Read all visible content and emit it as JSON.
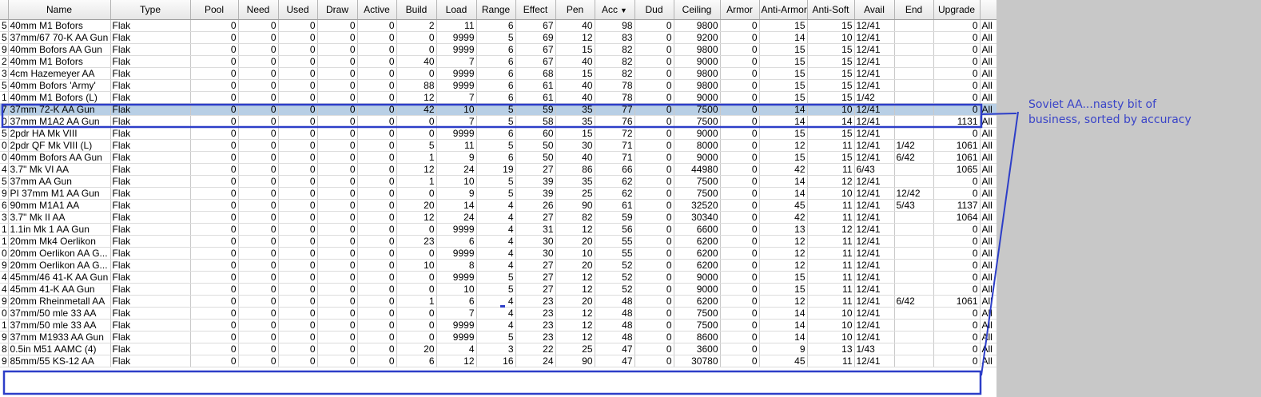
{
  "columns": [
    "",
    "Name",
    "Type",
    "Pool",
    "Need",
    "Used",
    "Draw",
    "Active",
    "Build",
    "Load",
    "Range",
    "Effect",
    "Pen",
    "Acc",
    "Dud",
    "Ceiling",
    "Armor",
    "Anti-Armor",
    "Anti-Soft",
    "Avail",
    "End",
    "Upgrade",
    ""
  ],
  "sort_indicator": "▼",
  "rows": [
    [
      "5",
      "40mm M1 Bofors",
      "Flak",
      "0",
      "0",
      "0",
      "0",
      "0",
      "2",
      "11",
      "6",
      "67",
      "40",
      "98",
      "0",
      "9800",
      "0",
      "15",
      "15",
      "12/41",
      "",
      "0",
      "All"
    ],
    [
      "5",
      "37mm/67 70-K AA Gun",
      "Flak",
      "0",
      "0",
      "0",
      "0",
      "0",
      "0",
      "9999",
      "5",
      "69",
      "12",
      "83",
      "0",
      "9200",
      "0",
      "14",
      "10",
      "12/41",
      "",
      "0",
      "All"
    ],
    [
      "9",
      "40mm Bofors AA Gun",
      "Flak",
      "0",
      "0",
      "0",
      "0",
      "0",
      "0",
      "9999",
      "6",
      "67",
      "15",
      "82",
      "0",
      "9800",
      "0",
      "15",
      "15",
      "12/41",
      "",
      "0",
      "All"
    ],
    [
      "2",
      "40mm M1 Bofors",
      "Flak",
      "0",
      "0",
      "0",
      "0",
      "0",
      "40",
      "7",
      "6",
      "67",
      "40",
      "82",
      "0",
      "9000",
      "0",
      "15",
      "15",
      "12/41",
      "",
      "0",
      "All"
    ],
    [
      "3",
      "4cm Hazemeyer AA",
      "Flak",
      "0",
      "0",
      "0",
      "0",
      "0",
      "0",
      "9999",
      "6",
      "68",
      "15",
      "82",
      "0",
      "9800",
      "0",
      "15",
      "15",
      "12/41",
      "",
      "0",
      "All"
    ],
    [
      "5",
      "40mm Bofors 'Army'",
      "Flak",
      "0",
      "0",
      "0",
      "0",
      "0",
      "88",
      "9999",
      "6",
      "61",
      "40",
      "78",
      "0",
      "9800",
      "0",
      "15",
      "15",
      "12/41",
      "",
      "0",
      "All"
    ],
    [
      "1",
      "40mm M1 Bofors (L)",
      "Flak",
      "0",
      "0",
      "0",
      "0",
      "0",
      "12",
      "7",
      "6",
      "61",
      "40",
      "78",
      "0",
      "9000",
      "0",
      "15",
      "15",
      "1/42",
      "",
      "0",
      "All"
    ],
    [
      "7",
      "37mm 72-K AA Gun",
      "Flak",
      "0",
      "0",
      "0",
      "0",
      "0",
      "42",
      "10",
      "5",
      "59",
      "35",
      "77",
      "0",
      "7500",
      "0",
      "14",
      "10",
      "12/41",
      "",
      "0",
      "All"
    ],
    [
      "0",
      "37mm M1A2 AA Gun",
      "Flak",
      "0",
      "0",
      "0",
      "0",
      "0",
      "0",
      "7",
      "5",
      "58",
      "35",
      "76",
      "0",
      "7500",
      "0",
      "14",
      "14",
      "12/41",
      "",
      "1131",
      "All"
    ],
    [
      "5",
      "2pdr HA Mk VIII",
      "Flak",
      "0",
      "0",
      "0",
      "0",
      "0",
      "0",
      "9999",
      "6",
      "60",
      "15",
      "72",
      "0",
      "9000",
      "0",
      "15",
      "15",
      "12/41",
      "",
      "0",
      "All"
    ],
    [
      "0",
      "2pdr QF Mk VIII (L)",
      "Flak",
      "0",
      "0",
      "0",
      "0",
      "0",
      "5",
      "11",
      "5",
      "50",
      "30",
      "71",
      "0",
      "8000",
      "0",
      "12",
      "11",
      "12/41",
      "1/42",
      "1061",
      "All"
    ],
    [
      "0",
      "40mm Bofors AA Gun",
      "Flak",
      "0",
      "0",
      "0",
      "0",
      "0",
      "1",
      "9",
      "6",
      "50",
      "40",
      "71",
      "0",
      "9000",
      "0",
      "15",
      "15",
      "12/41",
      "6/42",
      "1061",
      "All"
    ],
    [
      "4",
      "3.7\" Mk VI AA",
      "Flak",
      "0",
      "0",
      "0",
      "0",
      "0",
      "12",
      "24",
      "19",
      "27",
      "86",
      "66",
      "0",
      "44980",
      "0",
      "42",
      "11",
      "6/43",
      "",
      "1065",
      "All"
    ],
    [
      "5",
      "37mm AA Gun",
      "Flak",
      "0",
      "0",
      "0",
      "0",
      "0",
      "1",
      "10",
      "5",
      "39",
      "35",
      "62",
      "0",
      "7500",
      "0",
      "14",
      "12",
      "12/41",
      "",
      "0",
      "All"
    ],
    [
      "9",
      "PI 37mm M1 AA Gun",
      "Flak",
      "0",
      "0",
      "0",
      "0",
      "0",
      "0",
      "9",
      "5",
      "39",
      "25",
      "62",
      "0",
      "7500",
      "0",
      "14",
      "10",
      "12/41",
      "12/42",
      "0",
      "All"
    ],
    [
      "6",
      "90mm M1A1 AA",
      "Flak",
      "0",
      "0",
      "0",
      "0",
      "0",
      "20",
      "14",
      "4",
      "26",
      "90",
      "61",
      "0",
      "32520",
      "0",
      "45",
      "11",
      "12/41",
      "5/43",
      "1137",
      "All"
    ],
    [
      "3",
      "3.7\" Mk II AA",
      "Flak",
      "0",
      "0",
      "0",
      "0",
      "0",
      "12",
      "24",
      "4",
      "27",
      "82",
      "59",
      "0",
      "30340",
      "0",
      "42",
      "11",
      "12/41",
      "",
      "1064",
      "All"
    ],
    [
      "1",
      "1.1in Mk 1 AA Gun",
      "Flak",
      "0",
      "0",
      "0",
      "0",
      "0",
      "0",
      "9999",
      "4",
      "31",
      "12",
      "56",
      "0",
      "6600",
      "0",
      "13",
      "12",
      "12/41",
      "",
      "0",
      "All"
    ],
    [
      "1",
      "20mm Mk4 Oerlikon",
      "Flak",
      "0",
      "0",
      "0",
      "0",
      "0",
      "23",
      "6",
      "4",
      "30",
      "20",
      "55",
      "0",
      "6200",
      "0",
      "12",
      "11",
      "12/41",
      "",
      "0",
      "All"
    ],
    [
      "0",
      "20mm Oerlikon AA G...",
      "Flak",
      "0",
      "0",
      "0",
      "0",
      "0",
      "0",
      "9999",
      "4",
      "30",
      "10",
      "55",
      "0",
      "6200",
      "0",
      "12",
      "11",
      "12/41",
      "",
      "0",
      "All"
    ],
    [
      "9",
      "20mm Oerlikon AA G...",
      "Flak",
      "0",
      "0",
      "0",
      "0",
      "0",
      "10",
      "8",
      "4",
      "27",
      "20",
      "52",
      "0",
      "6200",
      "0",
      "12",
      "11",
      "12/41",
      "",
      "0",
      "All"
    ],
    [
      "4",
      "45mm/46 41-K AA Gun",
      "Flak",
      "0",
      "0",
      "0",
      "0",
      "0",
      "0",
      "9999",
      "5",
      "27",
      "12",
      "52",
      "0",
      "9000",
      "0",
      "15",
      "11",
      "12/41",
      "",
      "0",
      "All"
    ],
    [
      "4",
      "45mm 41-K AA Gun",
      "Flak",
      "0",
      "0",
      "0",
      "0",
      "0",
      "0",
      "10",
      "5",
      "27",
      "12",
      "52",
      "0",
      "9000",
      "0",
      "15",
      "11",
      "12/41",
      "",
      "0",
      "All"
    ],
    [
      "9",
      "20mm Rheinmetall AA",
      "Flak",
      "0",
      "0",
      "0",
      "0",
      "0",
      "1",
      "6",
      "4",
      "23",
      "20",
      "48",
      "0",
      "6200",
      "0",
      "12",
      "11",
      "12/41",
      "6/42",
      "1061",
      "All"
    ],
    [
      "0",
      "37mm/50 mle 33 AA",
      "Flak",
      "0",
      "0",
      "0",
      "0",
      "0",
      "0",
      "7",
      "4",
      "23",
      "12",
      "48",
      "0",
      "7500",
      "0",
      "14",
      "10",
      "12/41",
      "",
      "0",
      "All"
    ],
    [
      "1",
      "37mm/50 mle 33 AA",
      "Flak",
      "0",
      "0",
      "0",
      "0",
      "0",
      "0",
      "9999",
      "4",
      "23",
      "12",
      "48",
      "0",
      "7500",
      "0",
      "14",
      "10",
      "12/41",
      "",
      "0",
      "All"
    ],
    [
      "9",
      "37mm M1933 AA Gun",
      "Flak",
      "0",
      "0",
      "0",
      "0",
      "0",
      "0",
      "9999",
      "5",
      "23",
      "12",
      "48",
      "0",
      "8600",
      "0",
      "14",
      "10",
      "12/41",
      "",
      "0",
      "All"
    ],
    [
      "8",
      "0.5in M51 AAMC (4)",
      "Flak",
      "0",
      "0",
      "0",
      "0",
      "0",
      "20",
      "4",
      "3",
      "22",
      "25",
      "47",
      "0",
      "3600",
      "0",
      "9",
      "13",
      "1/43",
      "",
      "0",
      "All"
    ],
    [
      "9",
      "85mm/55 KS-12 AA",
      "Flak",
      "0",
      "0",
      "0",
      "0",
      "0",
      "6",
      "12",
      "16",
      "24",
      "90",
      "47",
      "0",
      "30780",
      "0",
      "45",
      "11",
      "12/41",
      "",
      "0",
      "All"
    ]
  ],
  "selected_row_index": 7,
  "annotation": {
    "text_line1": "Soviet AA...nasty bit of",
    "text_line2": "business, sorted by accuracy",
    "color": "#3a44c8"
  }
}
